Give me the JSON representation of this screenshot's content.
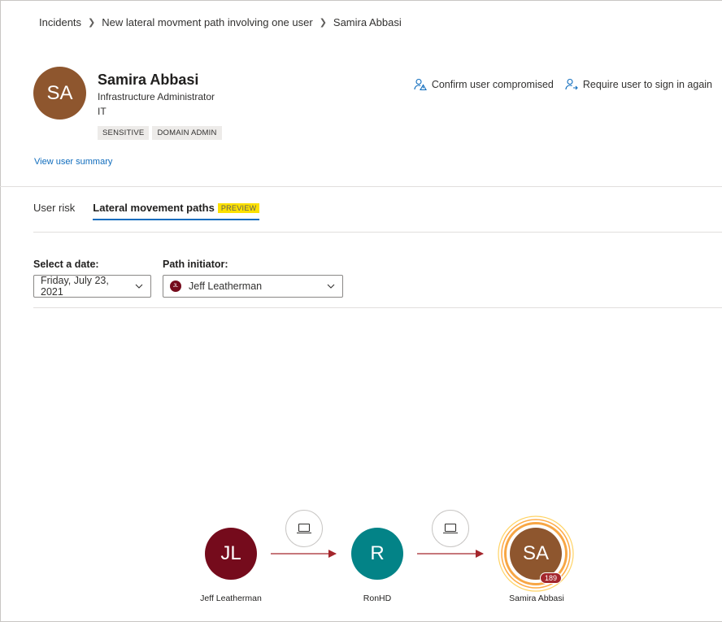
{
  "breadcrumb": [
    "Incidents",
    "New lateral movment path involving one user",
    "Samira Abbasi"
  ],
  "user": {
    "initials": "SA",
    "name": "Samira Abbasi",
    "title": "Infrastructure Administrator",
    "department": "IT",
    "tags": [
      "SENSITIVE",
      "DOMAIN ADMIN"
    ],
    "summary_link": "View user summary",
    "avatar_color": "#8e562e"
  },
  "actions": {
    "confirm": "Confirm user compromised",
    "require_signin": "Require user to sign in again"
  },
  "tabs": {
    "user_risk": "User risk",
    "lateral": "Lateral movement paths",
    "preview_badge": "PREVIEW"
  },
  "filters": {
    "date_label": "Select a date:",
    "date_value": "Friday, July 23, 2021",
    "initiator_label": "Path initiator:",
    "initiator_initials": "JL",
    "initiator_value": "Jeff Leatherman"
  },
  "graph": {
    "nodes": [
      {
        "initials": "JL",
        "name": "Jeff Leatherman",
        "color": "#750b1c"
      },
      {
        "initials": "R",
        "name": "RonHD",
        "color": "#038387"
      },
      {
        "initials": "SA",
        "name": "Samira Abbasi",
        "color": "#8e562e",
        "badge": "189"
      }
    ],
    "device_icon": "laptop-icon",
    "arrow_color": "#a4262c"
  },
  "colors": {
    "accent": "#0f6cbd",
    "preview": "#fce100",
    "ring": "#ffaa44"
  }
}
